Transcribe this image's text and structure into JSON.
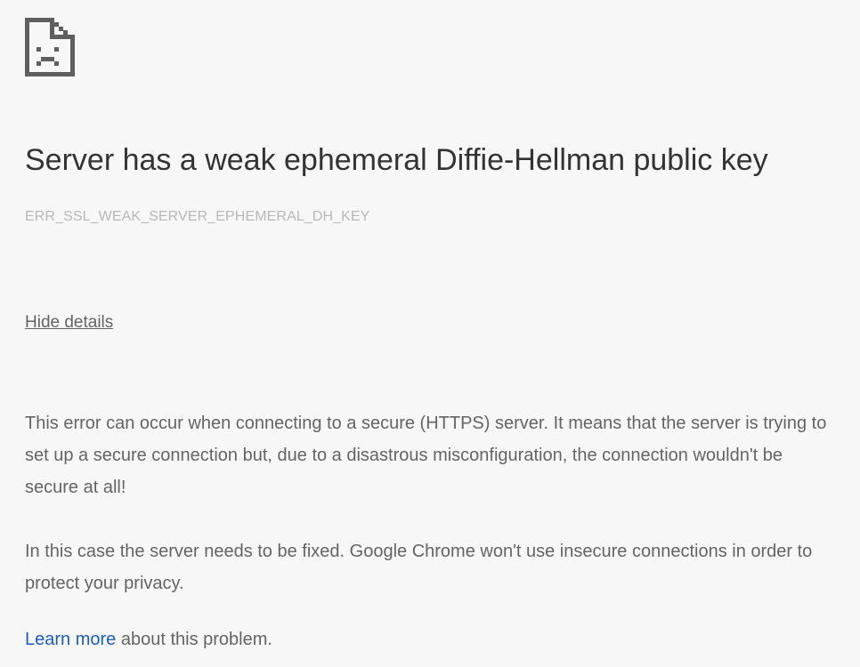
{
  "error_page": {
    "icon": "sad-page-icon",
    "title": "Server has a weak ephemeral Diffie-Hellman public key",
    "error_code": "ERR_SSL_WEAK_SERVER_EPHEMERAL_DH_KEY",
    "details_toggle_label": "Hide details",
    "details_paragraph_1": "This error can occur when connecting to a secure (HTTPS) server. It means that the server is trying to set up a secure connection but, due to a disastrous misconfiguration, the connection wouldn't be secure at all!",
    "details_paragraph_2": "In this case the server needs to be fixed. Google Chrome won't use insecure connections in order to protect your privacy.",
    "learn_more_link": "Learn more",
    "learn_more_suffix": " about this problem."
  },
  "colors": {
    "background": "#f7f7f7",
    "title_text": "#333333",
    "body_text": "#646464",
    "error_code_text": "#b8b8b8",
    "link": "#1a5ec2"
  }
}
